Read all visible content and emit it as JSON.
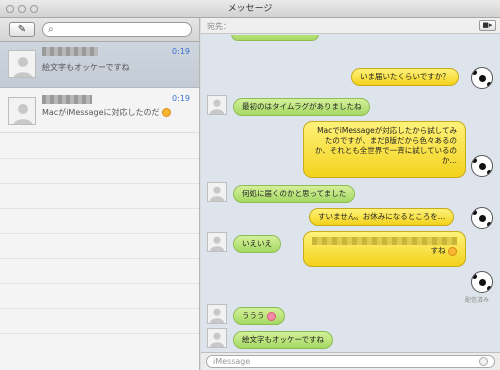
{
  "window": {
    "title": "メッセージ"
  },
  "sidebar": {
    "compose_icon": "compose-icon",
    "search_placeholder": "",
    "conversations": [
      {
        "time": "0:19",
        "preview": "絵文字もオッケーですね",
        "selected": true
      },
      {
        "time": "0:19",
        "preview": "MacがiMessageに対応したのだ",
        "selected": false
      }
    ]
  },
  "chat": {
    "to_label": "宛先：",
    "video_icon": "video-camera-icon",
    "messages": [
      {
        "dir": "out",
        "text": "いま届いたくらいですか？"
      },
      {
        "dir": "in",
        "text": "最初のはタイムラグがありましたね"
      },
      {
        "dir": "out",
        "text": "MacでiMessageが対応したから試してみたのですが、まだβ版だから色々あるのか、それとも全世界で一斉に試しているのか…"
      },
      {
        "dir": "in",
        "text": "何処に届くのかと思ってました"
      },
      {
        "dir": "out",
        "text": "すいません。お休みになるところを…"
      },
      {
        "dir": "in",
        "text": "いえいえ"
      },
      {
        "dir": "out",
        "text": "すね"
      },
      {
        "dir": "in",
        "text": "ううう"
      },
      {
        "dir": "in",
        "text": "絵文字もオッケーですね"
      }
    ],
    "delivered_label": "配信済み",
    "composer_placeholder": "iMessage"
  }
}
